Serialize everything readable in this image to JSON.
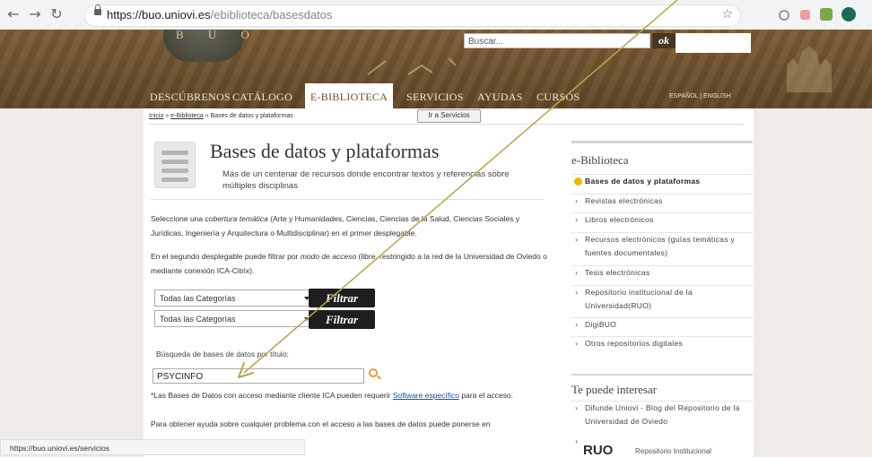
{
  "browser": {
    "url_host": "https://buo.uniovi.es",
    "url_path": "/ebiblioteca/basesdatos",
    "status_url": "https://buo.uniovi.es/servicios"
  },
  "header": {
    "logo_text": "B U O",
    "search_placeholder": "Buscar...",
    "ok_label": "ok",
    "nav": [
      "DESCÚBRENOS",
      "CATÁLOGO",
      "E-BIBLIOTECA",
      "SERVICIOS",
      "AYUDAS",
      "CURSOS"
    ],
    "lang": "ESPAÑOL  |  ENGLISH"
  },
  "breadcrumb": {
    "inicio": "Inicio",
    "sep1": " » ",
    "ebiblioteca": "e-Biblioteca",
    "sep2": " » ",
    "current": "Bases de datos y plataformas",
    "ir_label": "Ir a Servicios"
  },
  "main": {
    "title": "Bases de datos y plataformas",
    "subtitle": "Más de un centenar de recursos donde encontrar textos y referencias sobre múltiples disciplinas",
    "para1": {
      "a": "Seleccione una ",
      "em": "cobertura temática",
      "b": " (Arte y Humanidades, Ciencias, Ciencias de la Salud, Ciencias Sociales y Jurídicas, Ingeniería y Arquitectura o Multidisciplinar) en el primer desplegable."
    },
    "para2": {
      "a": "En el segundo desplegable puede filtrar por ",
      "em": "modo de acceso",
      "b": " (libre, restringido a la red de la Universidad de Oviedo o mediante conexión ICA-Citrix)."
    },
    "select1": "Todas las Categorías",
    "select2": "Todas las Categorías",
    "filter_label": "Filtrar",
    "query_label": "Búsqueda de bases de datos por título:",
    "query_value": "PSYCINFO",
    "note1": {
      "a": "*Las Bases de Datos con acceso mediante cliente ICA pueden requerir ",
      "link": "Software específico",
      "b": " para el acceso."
    },
    "note2": "Para obtener ayuda sobre cualquier problema con el acceso a las bases de datos puede ponerse en"
  },
  "sidebar": {
    "title": "e-Biblioteca",
    "items": [
      "Bases de datos y plataformas",
      "Revistas electrónicas",
      "Libros electrónicos",
      "Recursos electrónicos (guías temáticas y fuentes documentales)",
      "Tesis electrónicas",
      "Repositorio institucional de la Universidad(RUO)",
      "DigiBUO",
      "Otros repositorios digitales"
    ],
    "interest_title": "Te puede interesar",
    "interest_items": [
      "Difunde Uniovi - Blog del Repositorio de la Universidad de Oviedo"
    ],
    "ruo_logo": "RUO",
    "ruo_text": "Repositorio Institucional"
  },
  "colors": {
    "header_brown": "#6b4f2e",
    "sidebar_active_dot": "#f3b400",
    "annotation_line": "#b8a44a"
  }
}
